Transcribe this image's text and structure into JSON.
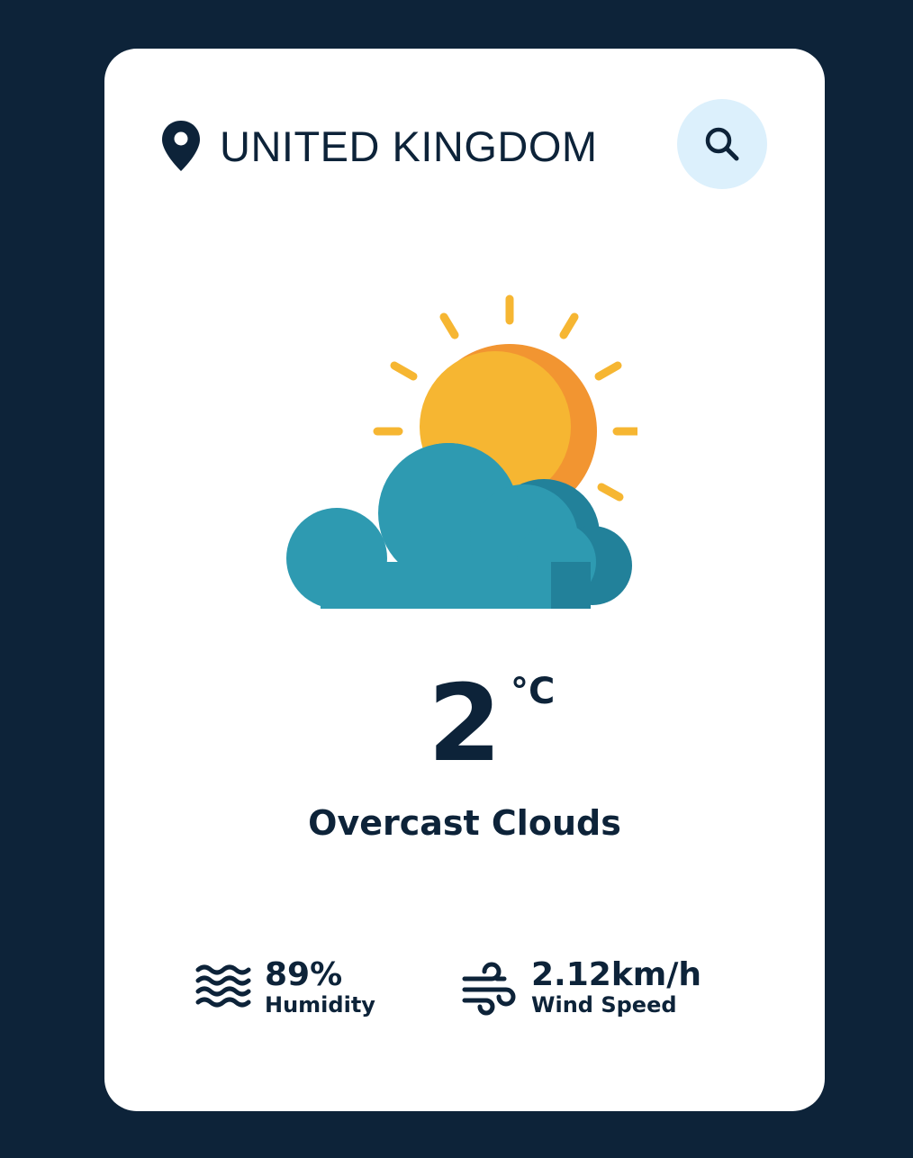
{
  "header": {
    "location": "UNITED KINGDOM",
    "location_icon": "map-pin-icon",
    "search_icon": "search-icon"
  },
  "weather": {
    "icon": "partly-cloudy-icon",
    "temperature": "2",
    "unit": "°C",
    "condition": "Overcast Clouds"
  },
  "details": {
    "humidity": {
      "icon": "humidity-waves-icon",
      "value": "89%",
      "label": "Humidity"
    },
    "wind": {
      "icon": "wind-icon",
      "value": "2.12km/h",
      "label": "Wind Speed"
    }
  },
  "colors": {
    "background": "#0d2339",
    "card": "#ffffff",
    "text": "#0d2339",
    "search_button_bg": "#dcf0fc",
    "sun": "#f6b632",
    "sun_shade": "#f29531",
    "cloud": "#2e9ab1",
    "cloud_shade": "#22819a"
  }
}
